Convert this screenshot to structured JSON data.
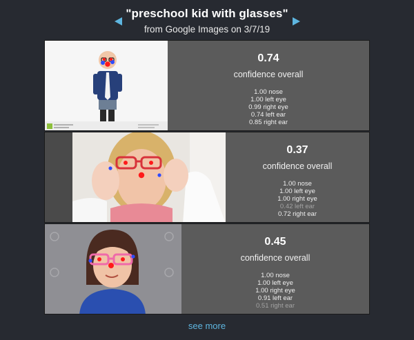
{
  "header": {
    "title": "\"preschool kid with glasses\"",
    "subtitle": "from Google Images on 3/7/19"
  },
  "colors": {
    "background": "#272a31",
    "card": "#5b5b5b",
    "accent": "#5eb6e0",
    "keypoint_red": "#ff1a1a",
    "keypoint_blue": "#2f4cff"
  },
  "results": [
    {
      "confidence": "0.74",
      "confidence_label": "confidence overall",
      "parts": [
        {
          "text": "1.00 nose",
          "low": false
        },
        {
          "text": "1.00 left eye",
          "low": false
        },
        {
          "text": "0.99 right eye",
          "low": false
        },
        {
          "text": "0.74 left ear",
          "low": false
        },
        {
          "text": "0.85 right ear",
          "low": false
        }
      ]
    },
    {
      "confidence": "0.37",
      "confidence_label": "confidence overall",
      "parts": [
        {
          "text": "1.00 nose",
          "low": false
        },
        {
          "text": "1.00 left eye",
          "low": false
        },
        {
          "text": "1.00 right eye",
          "low": false
        },
        {
          "text": "0.42 left ear",
          "low": true
        },
        {
          "text": "0.72 right ear",
          "low": false
        }
      ]
    },
    {
      "confidence": "0.45",
      "confidence_label": "confidence overall",
      "parts": [
        {
          "text": "1.00 nose",
          "low": false
        },
        {
          "text": "1.00 left eye",
          "low": false
        },
        {
          "text": "1.00 right eye",
          "low": false
        },
        {
          "text": "0.91 left ear",
          "low": false
        },
        {
          "text": "0.51 right ear",
          "low": true
        }
      ]
    }
  ],
  "see_more_label": "see more"
}
